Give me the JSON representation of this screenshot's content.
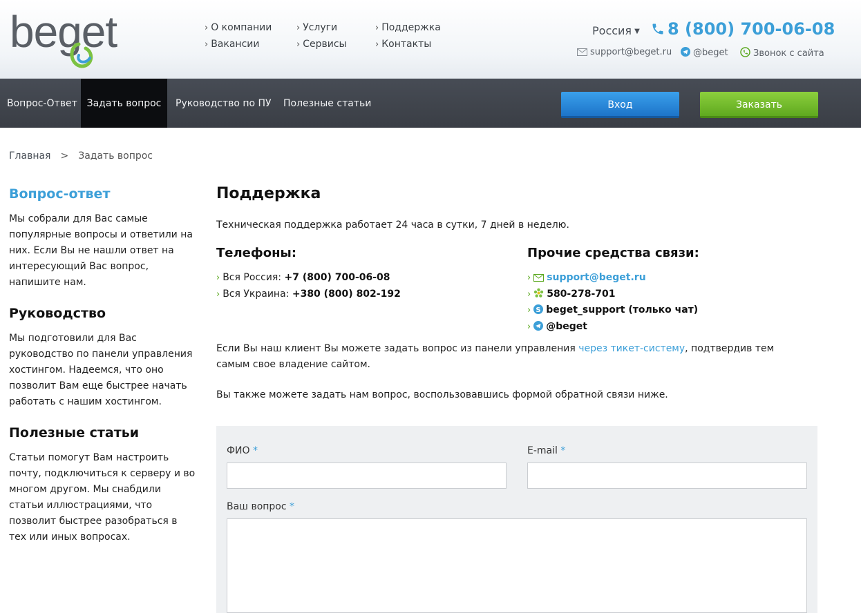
{
  "header": {
    "logo_text": "beget",
    "top_nav": [
      {
        "label": "О компании"
      },
      {
        "label": "Вакансии"
      },
      {
        "label": "Услуги"
      },
      {
        "label": "Сервисы"
      },
      {
        "label": "Поддержка"
      },
      {
        "label": "Контакты"
      }
    ],
    "region": "Россия",
    "phone": "8 (800) 700-06-08",
    "email": "support@beget.ru",
    "telegram": "@beget",
    "callback": "Звонок с сайта"
  },
  "main_nav": {
    "tabs": [
      {
        "label": "Вопрос-Ответ"
      },
      {
        "label": "Задать вопрос"
      },
      {
        "label": "Руководство по ПУ"
      },
      {
        "label": "Полезные статьи"
      }
    ],
    "login": "Вход",
    "order": "Заказать"
  },
  "breadcrumb": {
    "home": "Главная",
    "separator": ">",
    "current": "Задать вопрос"
  },
  "sidebar": [
    {
      "title": "Вопрос-ответ",
      "text": "Мы собрали для Вас самые популярные вопросы и ответили на них. Если Вы не нашли ответ на интересующий Вас вопрос, напишите нам."
    },
    {
      "title": "Руководство",
      "text": "Мы подготовили для Вас руководство по панели управления хостингом. Надеемся, что оно позволит Вам еще быстрее начать работать с нашим хостингом."
    },
    {
      "title": "Полезные статьи",
      "text": "Статьи помогут Вам настроить почту, подключиться к серверу и во многом другом. Мы снабдили статьи иллюстрациями, что позволит быстрее разобраться в тех или иных вопросах."
    }
  ],
  "main": {
    "title": "Поддержка",
    "intro": "Техническая поддержка работает 24 часа в сутки, 7 дней в неделю.",
    "phones_title": "Телефоны:",
    "phones": [
      {
        "label": "Вся Россия:",
        "value": "+7 (800) 700-06-08"
      },
      {
        "label": "Вся Украина:",
        "value": "+380 (800) 802-192"
      }
    ],
    "other_title": "Прочие средства связи:",
    "other": {
      "email": "support@beget.ru",
      "icq": "580-278-701",
      "skype": "beget_support (только чат)",
      "telegram": "@beget"
    },
    "ticket_text_before": "Если Вы наш клиент Вы можете задать вопрос из панели управления ",
    "ticket_link": "через тикет-систему",
    "ticket_text_after": ", подтвердив тем самым свое владение сайтом.",
    "form_intro": "Вы также можете задать нам вопрос, воспользовавшись формой обратной связи ниже."
  },
  "form": {
    "name_label": "ФИО",
    "email_label": "E-mail",
    "question_label": "Ваш вопрос",
    "required_mark": "*",
    "name_value": "",
    "email_value": "",
    "question_value": ""
  },
  "colors": {
    "accent": "#3c9fd8",
    "nav_bg": "#3f434a",
    "login_btn": "#2a88dc",
    "order_btn": "#72bb2c"
  }
}
